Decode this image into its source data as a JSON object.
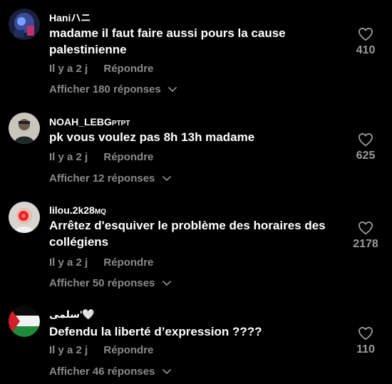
{
  "comments": [
    {
      "username": "Haniハニ",
      "username_suffix": "",
      "text": "madame il faut faire aussi pours la cause palestinienne",
      "time": "Il y a 2 j",
      "reply_label": "Répondre",
      "replies_label": "Afficher 180 réponses",
      "likes": "410"
    },
    {
      "username": "NOAH_LEBG",
      "username_suffix": "PTPT",
      "text": "pk vous voulez pas 8h 13h madame",
      "time": "Il y a 2 j",
      "reply_label": "Répondre",
      "replies_label": "Afficher 12 réponses",
      "likes": "625"
    },
    {
      "username": "lilou.2k28",
      "username_suffix": "MQ",
      "text": "Arrêtez d'esquiver le problème des horaires des collégiens",
      "time": "Il y a 2 j",
      "reply_label": "Répondre",
      "replies_label": "Afficher 50 réponses",
      "likes": "2178"
    },
    {
      "username": "سلمى'🤍",
      "username_suffix": "",
      "text": "Defendu la liberté d’expression ????",
      "time": "Il y a 2 j",
      "reply_label": "Répondre",
      "replies_label": "Afficher 46 réponses",
      "likes": "110"
    }
  ],
  "icons": {
    "like": "heart-outline-icon",
    "expand": "chevron-down-icon"
  },
  "colors": {
    "background": "#000000",
    "primary_text": "#ffffff",
    "secondary_text": "#8a8a8a"
  }
}
